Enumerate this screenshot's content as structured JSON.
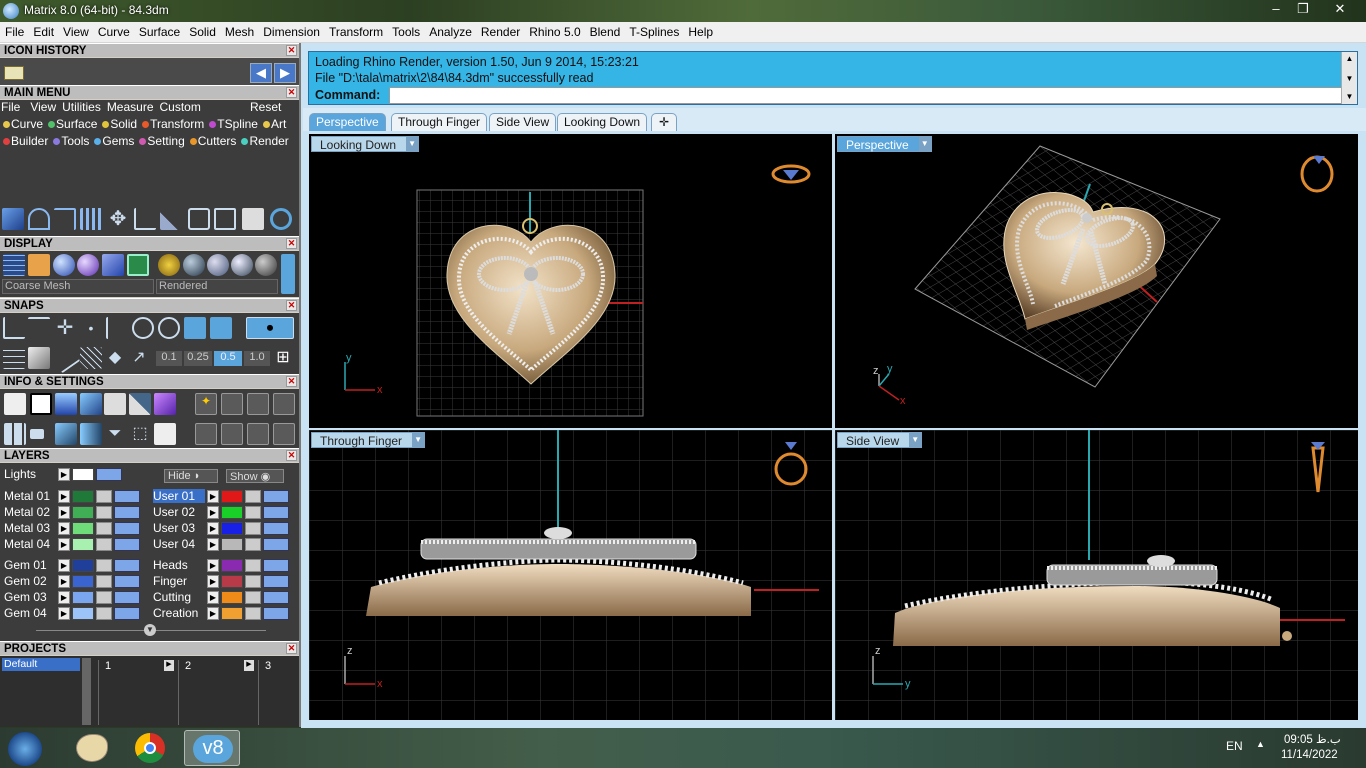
{
  "window": {
    "title": "Matrix 8.0 (64-bit) - 84.3dm",
    "controls": [
      "–",
      "❐",
      "✕"
    ]
  },
  "menu": [
    "File",
    "Edit",
    "View",
    "Curve",
    "Surface",
    "Solid",
    "Mesh",
    "Dimension",
    "Transform",
    "Tools",
    "Analyze",
    "Render",
    "Rhino 5.0",
    "Blend",
    "T-Splines",
    "Help"
  ],
  "left": {
    "icon_history": "ICON HISTORY",
    "main_menu": "MAIN MENU",
    "main_menu_row1": [
      "File",
      "View",
      "Utilities",
      "Measure",
      "Custom"
    ],
    "main_menu_reset": "Reset",
    "main_menu_row2": [
      {
        "label": "Curve",
        "color": "#e8c84a"
      },
      {
        "label": "Surface",
        "color": "#52c06a"
      },
      {
        "label": "Solid",
        "color": "#e0c43a"
      },
      {
        "label": "Transform",
        "color": "#e85a2a"
      },
      {
        "label": "TSpline",
        "color": "#c04ad0"
      },
      {
        "label": "Art",
        "color": "#e8c84a"
      }
    ],
    "main_menu_row3": [
      {
        "label": "Builder",
        "color": "#e04040"
      },
      {
        "label": "Tools",
        "color": "#8a7ae0"
      },
      {
        "label": "Gems",
        "color": "#5ab0e8"
      },
      {
        "label": "Setting",
        "color": "#d05ab0"
      },
      {
        "label": "Cutters",
        "color": "#e8962a"
      },
      {
        "label": "Render",
        "color": "#4ad0c0"
      }
    ],
    "display": "DISPLAY",
    "display_mesh": "Coarse Mesh",
    "display_mode": "Rendered",
    "snaps": "SNAPS",
    "snap_values": [
      "0.1",
      "0.25",
      "0.5",
      "1.0"
    ],
    "info_settings": "INFO & SETTINGS",
    "layers": "LAYERS",
    "lights": "Lights",
    "hide": "Hide",
    "show": "Show",
    "layers_left": [
      {
        "name": "Metal 01",
        "color": "#1f7a3a"
      },
      {
        "name": "Metal 02",
        "color": "#3fae55"
      },
      {
        "name": "Metal 03",
        "color": "#6fdc7a"
      },
      {
        "name": "Metal 04",
        "color": "#a8f0b0"
      },
      {
        "name": "Gem 01",
        "color": "#1f3f9a"
      },
      {
        "name": "Gem 02",
        "color": "#3a64d0"
      },
      {
        "name": "Gem 03",
        "color": "#7aa6f0"
      },
      {
        "name": "Gem 04",
        "color": "#9cc4f8"
      }
    ],
    "layers_right": [
      {
        "name": "User 01",
        "color": "#e01818"
      },
      {
        "name": "User 02",
        "color": "#18d028"
      },
      {
        "name": "User 03",
        "color": "#1820e8"
      },
      {
        "name": "User 04",
        "color": "#b8b8b8"
      },
      {
        "name": "Heads",
        "color": "#8a2ab0"
      },
      {
        "name": "Finger",
        "color": "#b83a48"
      },
      {
        "name": "Cutting",
        "color": "#f08a18"
      },
      {
        "name": "Creation",
        "color": "#f0a030"
      }
    ],
    "projects": "PROJECTS",
    "project_default": "Default",
    "project_cols": [
      "1",
      "2",
      "3"
    ]
  },
  "command": {
    "line1": "Loading Rhino Render, version 1.50, Jun  9 2014, 15:23:21",
    "line2": "File \"D:\\tala\\matrix\\2\\84\\84.3dm\" successfully read",
    "label": "Command:",
    "value": ""
  },
  "tabs": [
    "Perspective",
    "Through Finger",
    "Side View",
    "Looking Down",
    "✛"
  ],
  "viewports": {
    "top_left": "Looking Down",
    "top_right": "Perspective",
    "bottom_left": "Through Finger",
    "bottom_right": "Side View"
  },
  "axes": {
    "top_left": [
      "y",
      "x"
    ],
    "top_right": [
      "z",
      "y",
      "x"
    ],
    "bottom_left": [
      "z",
      "x"
    ],
    "bottom_right": [
      "z",
      "y"
    ]
  },
  "taskbar": {
    "apps": [
      "windows-start",
      "paint",
      "chrome",
      "v8"
    ],
    "v8_label": "v8",
    "language": "EN",
    "time": "09:05 ب.ظ",
    "date": "11/14/2022"
  },
  "colors": {
    "command_bg": "#35b4e6",
    "tab_active": "#5aa5dc",
    "gold": "#c8a97e"
  }
}
